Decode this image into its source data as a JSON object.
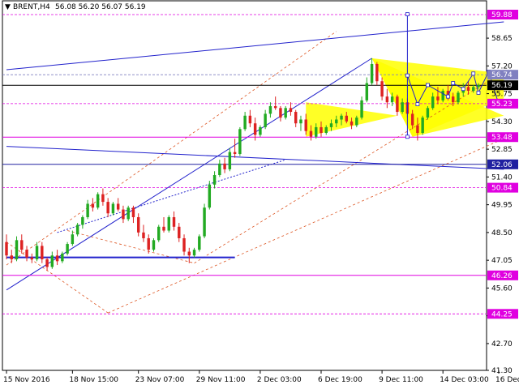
{
  "header": {
    "marker": "▼",
    "symbol_timeframe": "BRENT,H4",
    "ohlc": "56.08 56.20 56.07 56.19"
  },
  "chart_data": {
    "type": "candlestick",
    "symbol": "BRENT",
    "timeframe": "H4",
    "open": 56.08,
    "high": 56.2,
    "low": 56.07,
    "close": 56.19,
    "ylim": [
      41.3,
      60.6
    ],
    "y_ticks": [
      "58.65",
      "57.20",
      "55.75",
      "54.30",
      "52.85",
      "51.40",
      "49.95",
      "48.50",
      "47.05",
      "45.60",
      "44.15",
      "42.70",
      "41.30"
    ],
    "x_ticks": [
      "15 Nov 2016",
      "18 Nov 15:00",
      "23 Nov 07:00",
      "29 Nov 11:00",
      "2 Dec 03:00",
      "6 Dec 19:00",
      "9 Dec 11:00",
      "14 Dec 03:00",
      "16 Dec 19:00"
    ],
    "levels": [
      {
        "label": "59.88",
        "value": 59.88,
        "color": "#e000e0",
        "dashed": true
      },
      {
        "label": "56.74",
        "value": 56.74,
        "color": "#8080c0",
        "dashed": true
      },
      {
        "label": "56.19",
        "value": 56.19,
        "color": "#000000",
        "dashed": false
      },
      {
        "label": "55.23",
        "value": 55.23,
        "color": "#e000e0",
        "dashed": true
      },
      {
        "label": "53.48",
        "value": 53.48,
        "color": "#e000e0",
        "dashed": false
      },
      {
        "label": "52.06",
        "value": 52.06,
        "color": "#2020a0",
        "dashed": false
      },
      {
        "label": "50.84",
        "value": 50.84,
        "color": "#e000e0",
        "dashed": true
      },
      {
        "label": "46.26",
        "value": 46.26,
        "color": "#e000e0",
        "dashed": false
      },
      {
        "label": "44.25",
        "value": 44.25,
        "color": "#e000e0",
        "dashed": true
      }
    ],
    "colors": {
      "up": "#22aa22",
      "down": "#dd2222",
      "wedge": "#ffff00",
      "forecast": "#2222cc",
      "trend_dash": "#dd5522"
    },
    "candles": [
      [
        48.0,
        48.4,
        47.1,
        47.3
      ],
      [
        47.3,
        47.6,
        46.9,
        47.1
      ],
      [
        47.1,
        48.3,
        47.0,
        48.1
      ],
      [
        48.1,
        48.4,
        47.4,
        47.6
      ],
      [
        47.6,
        47.8,
        47.0,
        47.2
      ],
      [
        47.2,
        47.4,
        46.9,
        47.1
      ],
      [
        47.1,
        48.0,
        47.0,
        47.8
      ],
      [
        47.8,
        48.0,
        46.9,
        47.1
      ],
      [
        47.1,
        47.2,
        46.5,
        46.7
      ],
      [
        46.7,
        47.5,
        46.6,
        47.3
      ],
      [
        47.3,
        47.6,
        46.8,
        47.0
      ],
      [
        47.0,
        47.5,
        46.9,
        47.4
      ],
      [
        47.4,
        48.0,
        47.3,
        47.9
      ],
      [
        47.9,
        48.6,
        47.8,
        48.4
      ],
      [
        48.4,
        49.0,
        48.3,
        48.9
      ],
      [
        48.9,
        49.4,
        48.7,
        49.3
      ],
      [
        49.3,
        50.2,
        49.2,
        50.0
      ],
      [
        50.0,
        50.3,
        49.6,
        49.8
      ],
      [
        49.8,
        50.6,
        49.7,
        50.5
      ],
      [
        50.5,
        50.8,
        49.9,
        50.1
      ],
      [
        50.1,
        50.3,
        49.3,
        49.5
      ],
      [
        49.5,
        50.1,
        49.4,
        50.0
      ],
      [
        50.0,
        50.3,
        49.6,
        49.7
      ],
      [
        49.7,
        49.9,
        49.0,
        49.2
      ],
      [
        49.2,
        49.9,
        49.1,
        49.8
      ],
      [
        49.8,
        49.9,
        49.0,
        49.3
      ],
      [
        49.3,
        49.5,
        48.3,
        48.5
      ],
      [
        48.5,
        48.9,
        48.0,
        48.2
      ],
      [
        48.2,
        48.4,
        47.4,
        47.6
      ],
      [
        47.6,
        48.2,
        47.5,
        48.1
      ],
      [
        48.1,
        48.9,
        48.0,
        48.8
      ],
      [
        48.8,
        49.3,
        48.5,
        48.6
      ],
      [
        48.6,
        49.4,
        48.5,
        49.3
      ],
      [
        49.3,
        49.6,
        48.6,
        48.8
      ],
      [
        48.8,
        49.0,
        48.0,
        48.2
      ],
      [
        48.2,
        48.4,
        47.3,
        47.5
      ],
      [
        47.5,
        47.7,
        46.9,
        47.3
      ],
      [
        47.3,
        47.7,
        47.2,
        47.6
      ],
      [
        47.6,
        48.4,
        47.5,
        48.3
      ],
      [
        48.3,
        50.0,
        48.2,
        49.8
      ],
      [
        49.8,
        51.2,
        49.7,
        51.0
      ],
      [
        51.0,
        51.7,
        50.8,
        51.5
      ],
      [
        51.5,
        52.3,
        51.4,
        52.1
      ],
      [
        52.1,
        52.4,
        51.6,
        51.8
      ],
      [
        51.8,
        52.9,
        51.7,
        52.7
      ],
      [
        52.7,
        53.4,
        52.4,
        52.6
      ],
      [
        52.6,
        54.0,
        52.5,
        53.9
      ],
      [
        53.9,
        54.8,
        53.8,
        54.6
      ],
      [
        54.6,
        54.9,
        54.0,
        54.2
      ],
      [
        54.2,
        54.5,
        53.3,
        53.6
      ],
      [
        53.6,
        54.1,
        53.5,
        54.0
      ],
      [
        54.0,
        54.9,
        53.9,
        54.7
      ],
      [
        54.7,
        55.3,
        54.5,
        55.1
      ],
      [
        55.1,
        55.6,
        54.9,
        55.0
      ],
      [
        55.0,
        55.1,
        54.3,
        54.5
      ],
      [
        54.5,
        55.1,
        54.4,
        55.0
      ],
      [
        55.0,
        55.3,
        54.6,
        54.8
      ],
      [
        54.8,
        54.9,
        54.0,
        54.2
      ],
      [
        54.2,
        54.6,
        53.8,
        54.4
      ],
      [
        54.4,
        54.7,
        53.6,
        53.8
      ],
      [
        53.8,
        54.1,
        53.3,
        53.5
      ],
      [
        53.5,
        54.2,
        53.4,
        54.0
      ],
      [
        54.0,
        54.3,
        53.5,
        53.7
      ],
      [
        53.7,
        54.1,
        53.6,
        54.0
      ],
      [
        54.0,
        54.4,
        53.8,
        54.2
      ],
      [
        54.2,
        54.6,
        54.0,
        54.4
      ],
      [
        54.4,
        54.7,
        54.1,
        54.6
      ],
      [
        54.6,
        54.8,
        54.2,
        54.3
      ],
      [
        54.3,
        54.5,
        53.9,
        54.1
      ],
      [
        54.1,
        54.6,
        54.0,
        54.5
      ],
      [
        54.5,
        55.6,
        54.4,
        55.4
      ],
      [
        55.4,
        56.6,
        55.3,
        56.3
      ],
      [
        56.3,
        57.6,
        56.2,
        57.3
      ],
      [
        57.3,
        57.4,
        56.2,
        56.4
      ],
      [
        56.4,
        56.6,
        55.4,
        55.6
      ],
      [
        55.6,
        56.0,
        55.0,
        55.3
      ],
      [
        55.3,
        55.8,
        55.1,
        55.6
      ],
      [
        55.6,
        55.7,
        54.6,
        54.8
      ],
      [
        54.8,
        55.5,
        54.7,
        55.3
      ],
      [
        55.3,
        55.5,
        54.5,
        54.7
      ],
      [
        54.7,
        54.9,
        53.9,
        54.1
      ],
      [
        54.1,
        54.5,
        53.3,
        53.7
      ],
      [
        53.7,
        54.6,
        53.6,
        54.5
      ],
      [
        54.5,
        55.1,
        54.4,
        55.0
      ],
      [
        55.0,
        55.8,
        54.9,
        55.6
      ],
      [
        55.6,
        56.1,
        55.2,
        55.4
      ],
      [
        55.4,
        56.0,
        55.3,
        55.9
      ],
      [
        55.9,
        56.2,
        55.4,
        55.6
      ],
      [
        55.6,
        55.8,
        55.1,
        55.3
      ],
      [
        55.3,
        55.9,
        55.2,
        55.8
      ],
      [
        55.8,
        56.3,
        55.6,
        56.1
      ],
      [
        56.1,
        56.4,
        55.7,
        55.9
      ],
      [
        55.9,
        56.2,
        55.8,
        56.1
      ],
      [
        56.1,
        56.3,
        56.0,
        56.2
      ]
    ]
  }
}
